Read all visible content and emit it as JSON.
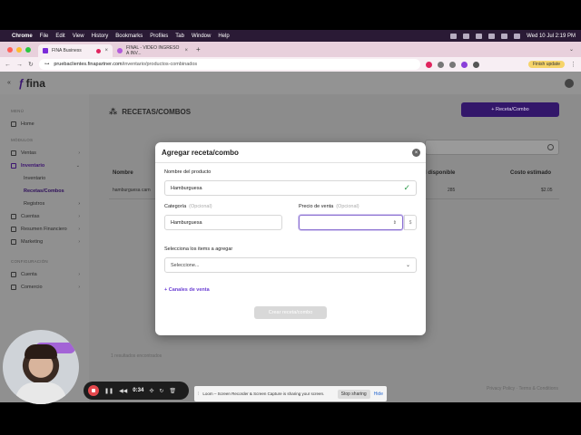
{
  "menubar": {
    "app": "Chrome",
    "menus": [
      "File",
      "Edit",
      "View",
      "History",
      "Bookmarks",
      "Profiles",
      "Tab",
      "Window",
      "Help"
    ],
    "clock": "Wed 10 Jul  2:19 PM"
  },
  "tabs": [
    {
      "title": "FINA Business"
    },
    {
      "title": "FINAL - VIDEO INGRESO A INV..."
    }
  ],
  "toolbar": {
    "url_host": "pruebaclientes.finapartner.com",
    "url_path": "/inventario/productos-combinados",
    "finish_update": "Finish update"
  },
  "app": {
    "logo": "fina",
    "sidebar": {
      "section_main": "MENÚ",
      "home": "Home",
      "section_modules": "MÓDULOS",
      "items": {
        "ventas": "Ventas",
        "inventario": "Inventario",
        "inventario_sub": "Inventario",
        "recetas": "Recetas/Combos",
        "registros": "Registros",
        "cuentas": "Cuentas",
        "resumen": "Resumen Financiero",
        "marketing": "Marketing"
      },
      "section_config": "CONFIGURACIÓN",
      "cuenta": "Cuenta",
      "comercio": "Comercio"
    },
    "page_title": "RECETAS/COMBOS",
    "add_button": "+ Receta/Combo",
    "table": {
      "col_name": "Nombre",
      "col_available": "l disponible",
      "col_cost": "Costo estimado",
      "row": {
        "name": "hamburguesa carn",
        "available": "285",
        "cost": "$2.05"
      },
      "footer": "1 resultados encontrados"
    },
    "footer_links": "Privacy Policy · Terms & Conditions"
  },
  "modal": {
    "title": "Agregar receta/combo",
    "close": "×",
    "product_name_label": "Nombre del producto",
    "product_name_value": "Hamburguesa",
    "category_label": "Categoría",
    "category_optional": "(Opcional)",
    "category_value": "Hamburguesa",
    "price_label": "Precio de venta",
    "price_optional": "(Opcional)",
    "price_value": "",
    "currency": "$",
    "items_label": "Selecciona los items a agregar",
    "items_placeholder": "Seleccione...",
    "sales_channels": "+ Canales de venta",
    "create_button": "Crear receta/combo"
  },
  "loom": {
    "timer": "0:34",
    "share_message": "Loom – Screen Recorder & Screen Capture is sharing your screen.",
    "stop_sharing": "Stop sharing",
    "hide": "Hide"
  },
  "colors": {
    "brand": "#33176a",
    "accent": "#6b3fd3",
    "success": "#2a9a4a",
    "record": "#e5484d"
  }
}
